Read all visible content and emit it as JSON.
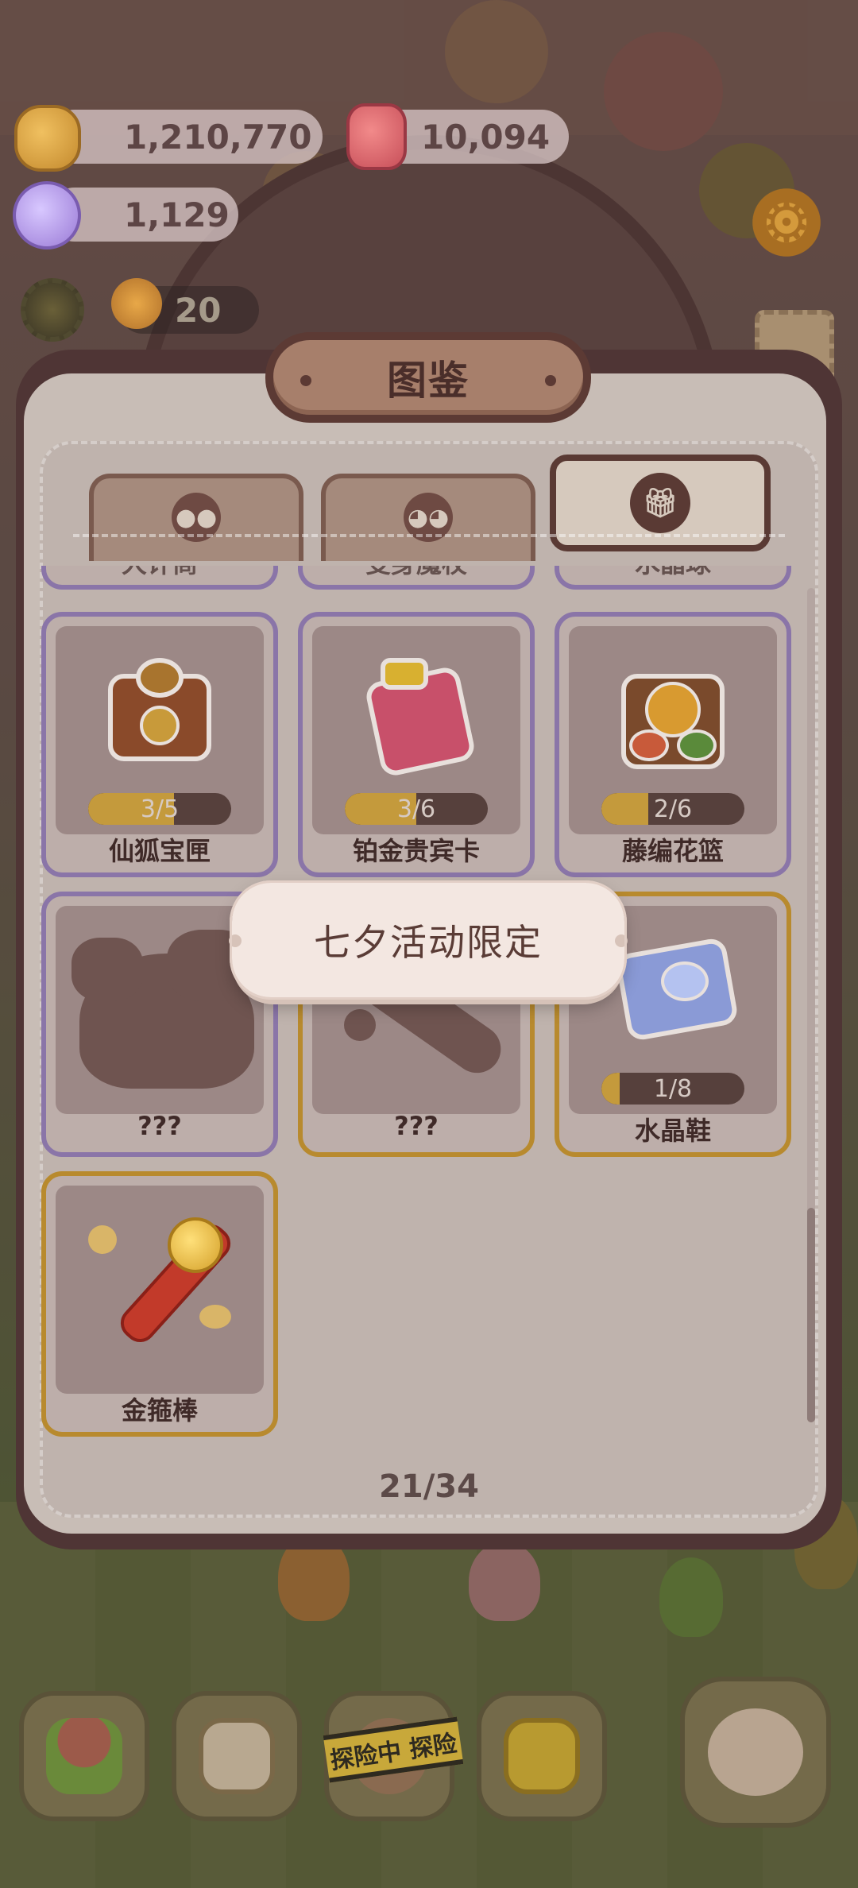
{
  "resources": {
    "coins": "1,210,770",
    "gems": "10,094",
    "candy": "1,129",
    "energy": "20"
  },
  "album": {
    "title": "图鉴",
    "tabs": [
      {
        "icon": "bear-face-icon",
        "active": false
      },
      {
        "icon": "character-face-icon",
        "active": false
      },
      {
        "icon": "gift-icon",
        "active": true
      }
    ],
    "partial_row": [
      "大计商",
      "变身魔杖",
      "水晶球"
    ],
    "items": [
      {
        "name": "仙狐宝匣",
        "progress": "3/5",
        "fill": 0.6,
        "frame": "purple",
        "revealed": true
      },
      {
        "name": "铂金贵宾卡",
        "progress": "3/6",
        "fill": 0.5,
        "frame": "purple",
        "revealed": true
      },
      {
        "name": "藤编花篮",
        "progress": "2/6",
        "fill": 0.33,
        "frame": "purple",
        "revealed": true
      },
      {
        "name": "???",
        "frame": "purple",
        "revealed": false
      },
      {
        "name": "???",
        "frame": "gold",
        "revealed": false
      },
      {
        "name": "水晶鞋",
        "progress": "1/8",
        "fill": 0.125,
        "frame": "gold",
        "revealed": true
      },
      {
        "name": "金箍棒",
        "frame": "gold",
        "revealed": true
      }
    ],
    "page_counter": "21/34"
  },
  "tooltip": {
    "text": "七夕活动限定"
  },
  "bottom_nav": {
    "adventure_label": "探险中 探险"
  },
  "colors": {
    "panel_border": "#4f3535",
    "purple_frame": "#8a75a8",
    "gold_frame": "#b88a2e",
    "progress_fill": "#c49a3c"
  }
}
